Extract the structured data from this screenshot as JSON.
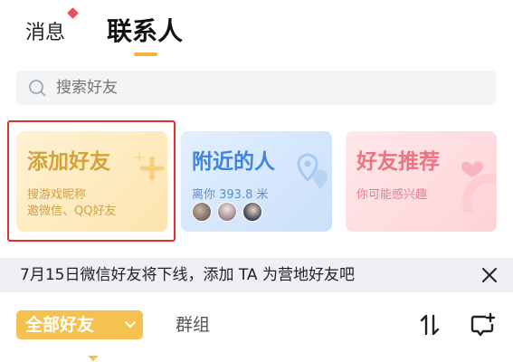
{
  "header": {
    "tabs": [
      {
        "label": "消息",
        "has_badge": true
      },
      {
        "label": "联系人",
        "active": true
      }
    ],
    "accent_color": "#f1b437",
    "badge_color": "#e8505b"
  },
  "search": {
    "placeholder": "搜索好友",
    "icon": "search-icon"
  },
  "cards": [
    {
      "title": "添加好友",
      "sub_lines": [
        "搜游戏昵称",
        "邀微信、QQ好友"
      ],
      "color": "#d5a23a",
      "highlighted": true
    },
    {
      "title": "附近的人",
      "subtitle": "离你 393.8 米",
      "avatar_count": 3,
      "color": "#3f85de"
    },
    {
      "title": "好友推荐",
      "subtitle": "你可能感兴趣",
      "color": "#ec7380"
    }
  ],
  "notice": {
    "text": "7月15日微信好友将下线，添加 TA 为营地好友吧",
    "close_icon": "close-icon"
  },
  "filter": {
    "selected": "全部好友",
    "groups_tab": "群组",
    "pill_color": "#f6c24f",
    "icons": [
      "chevron-down-icon",
      "sort-icon",
      "add-chat-icon"
    ]
  }
}
